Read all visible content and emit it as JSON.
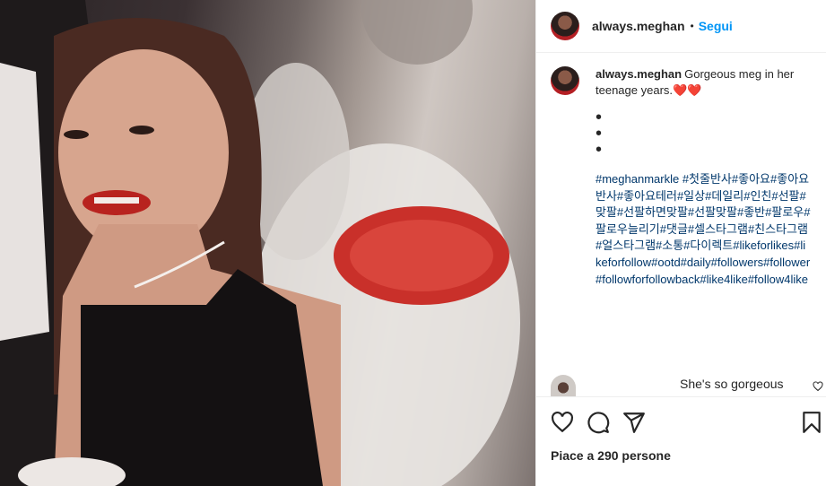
{
  "post": {
    "username": "always.meghan",
    "follow_label": "Segui",
    "separator": "•",
    "caption_text": "Gorgeous meg in her teenage years.❤️❤️",
    "bullets": [
      "•",
      "•",
      "•"
    ],
    "hashtags": "#meghanmarkle #첫줄반사#좋아요#좋아요반사#좋아요테러#일상#데일리#인친#선팔#맞팔#선팔하면맞팔#선팔맞팔#좋반#팔로우#팔로우늘리기#댓글#셀스타그램#친스타그램#얼스타그램#소통#다이렉트#likeforlikes#likeforfollow#ootd#daily#followers#follower#followforfollowback#like4like#follow4like"
  },
  "comment": {
    "text": "She's so gorgeous",
    "icon": "heart-outline-icon"
  },
  "actions": {
    "icons": [
      "heart-icon",
      "comment-icon",
      "share-icon",
      "bookmark-icon"
    ]
  },
  "likes": {
    "label": "Piace a 290 persone"
  },
  "colors": {
    "accent": "#0095f6",
    "hashtag": "#00376b",
    "heart": "#ed4956"
  }
}
